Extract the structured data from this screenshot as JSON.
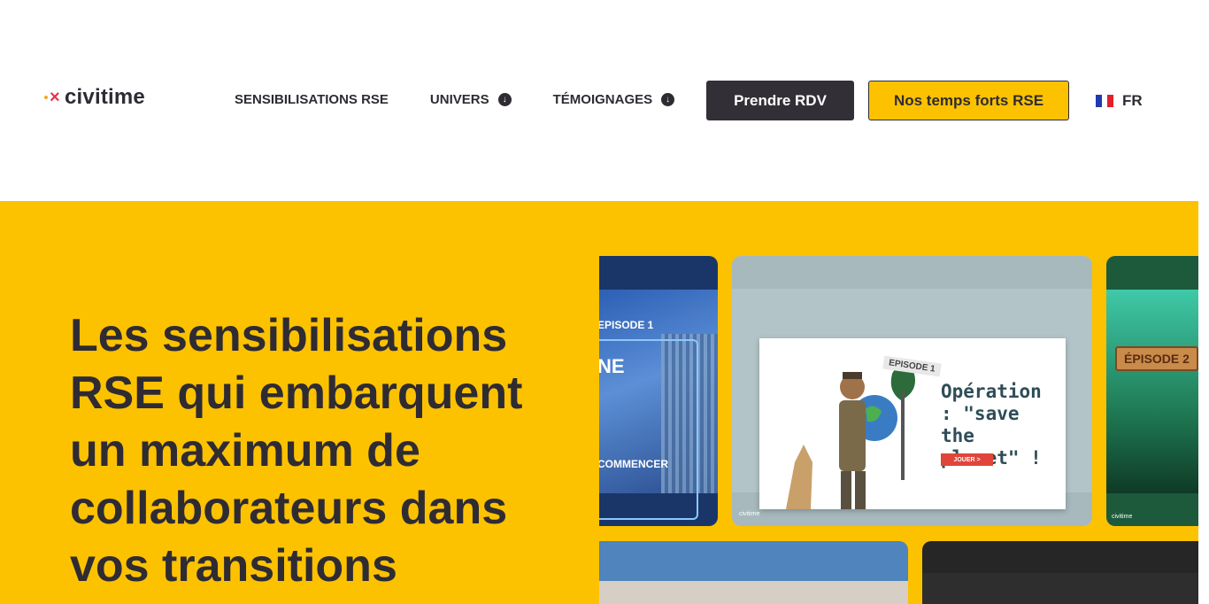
{
  "brand": {
    "name": "civitime"
  },
  "nav": {
    "items": [
      {
        "label": "SENSIBILISATIONS RSE",
        "dropdown": false
      },
      {
        "label": "UNIVERS",
        "dropdown": true
      },
      {
        "label": "TÉMOIGNAGES",
        "dropdown": true
      }
    ],
    "cta_primary": "Prendre RDV",
    "cta_secondary": "Nos temps forts RSE",
    "language": "FR"
  },
  "hero": {
    "title": "Les sensibilisations RSE qui embarquent un maximum de collaborateurs dans vos transitions"
  },
  "gallery": {
    "card1": {
      "episode": "EPISODE 1",
      "title_fragment": "NE",
      "button": "COMMENCER"
    },
    "card2": {
      "episode": "EPISODE 1",
      "title": "Opération : \"save the planet\" !",
      "button": "JOUER >",
      "logo": "civitime"
    },
    "card3": {
      "episode": "ÉPISODE 2",
      "logo": "civitime"
    }
  },
  "colors": {
    "brand_yellow": "#fcc200",
    "dark": "#2f2b33",
    "accent_red": "#e8334a"
  }
}
